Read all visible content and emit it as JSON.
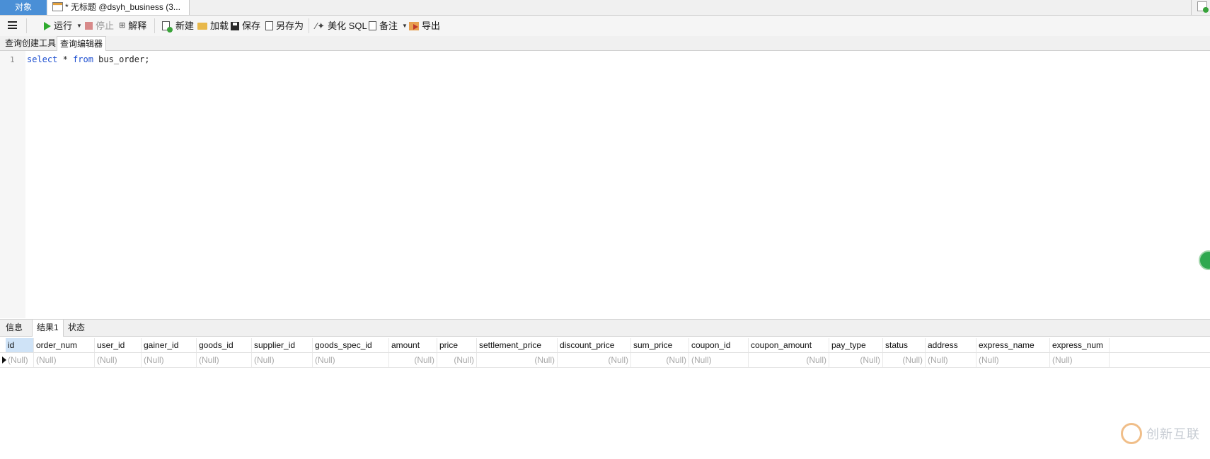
{
  "tabs": {
    "objects": "对象",
    "query_tab": "* 无标题 @dsyh_business (3..."
  },
  "toolbar": {
    "run": "运行",
    "stop": "停止",
    "explain": "解释",
    "new": "新建",
    "load": "加载",
    "save": "保存",
    "save_as": "另存为",
    "beautify": "美化 SQL",
    "comment": "备注",
    "export": "导出"
  },
  "subtabs": {
    "query_builder": "查询创建工具",
    "query_editor": "查询编辑器"
  },
  "editor": {
    "line_number": "1",
    "kw_select": "select",
    "star": " * ",
    "kw_from": "from",
    "rest": " bus_order;"
  },
  "result_tabs": {
    "info": "信息",
    "result1": "结果1",
    "status": "状态"
  },
  "grid": {
    "columns": [
      "id",
      "order_num",
      "user_id",
      "gainer_id",
      "goods_id",
      "supplier_id",
      "goods_spec_id",
      "amount",
      "price",
      "settlement_price",
      "discount_price",
      "sum_price",
      "coupon_id",
      "coupon_amount",
      "pay_type",
      "status",
      "address",
      "express_name",
      "express_num"
    ],
    "null_text": "(Null)"
  },
  "watermark": "创新互联"
}
